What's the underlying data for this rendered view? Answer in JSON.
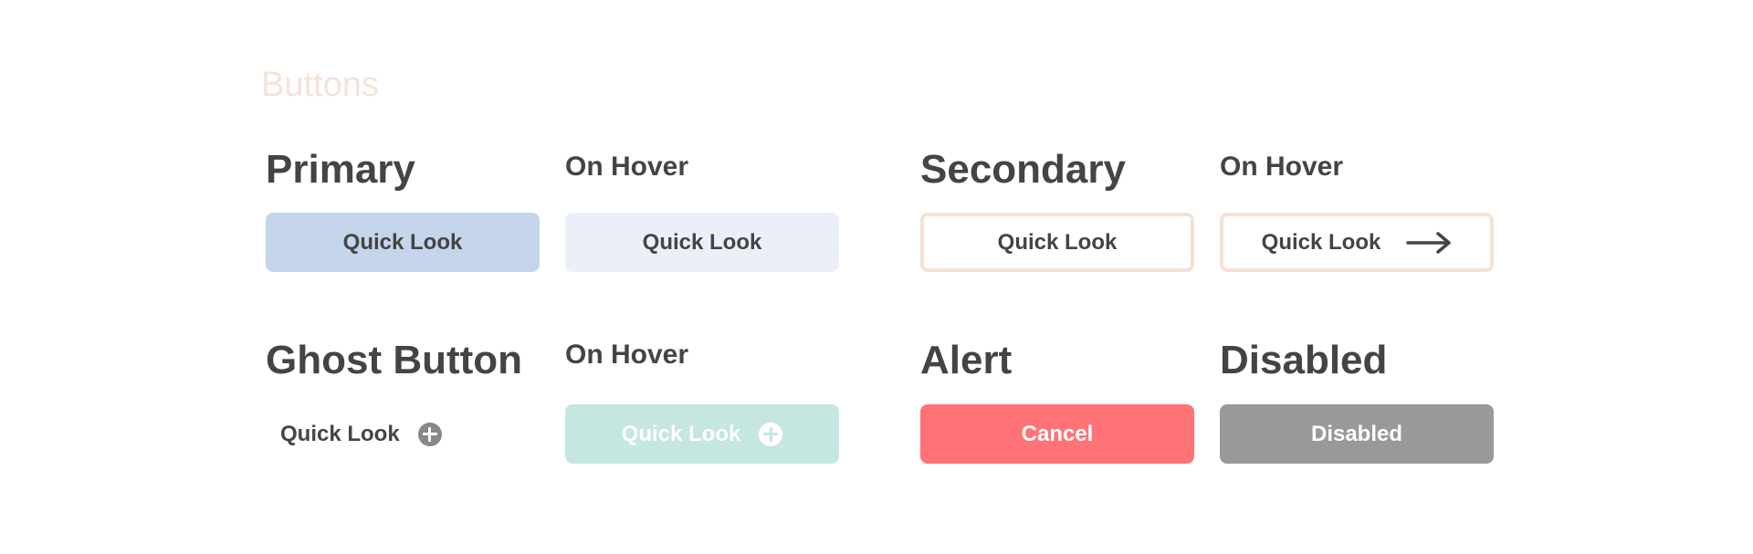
{
  "section": {
    "title": "Buttons"
  },
  "primary": {
    "heading": "Primary",
    "hover_heading": "On Hover",
    "button_label": "Quick Look",
    "hover_button_label": "Quick Look"
  },
  "secondary": {
    "heading": "Secondary",
    "hover_heading": "On Hover",
    "button_label": "Quick Look",
    "hover_button_label": "Quick Look",
    "hover_icon": "arrow-right-icon"
  },
  "ghost": {
    "heading": "Ghost Button",
    "hover_heading": "On Hover",
    "button_label": "Quick Look",
    "hover_button_label": "Quick Look",
    "icon": "plus-circle-icon"
  },
  "alert": {
    "heading": "Alert",
    "button_label": "Cancel"
  },
  "disabled": {
    "heading": "Disabled",
    "button_label": "Disabled"
  },
  "colors": {
    "section_title": "#f6e3d8",
    "text": "#444444",
    "primary_bg": "#c5d5eb",
    "primary_hover_bg": "#ebf0f8",
    "secondary_border": "#f6e1d4",
    "ghost_hover_bg": "#c6e6e2",
    "alert_bg": "#ff7376",
    "disabled_bg": "#999999"
  }
}
